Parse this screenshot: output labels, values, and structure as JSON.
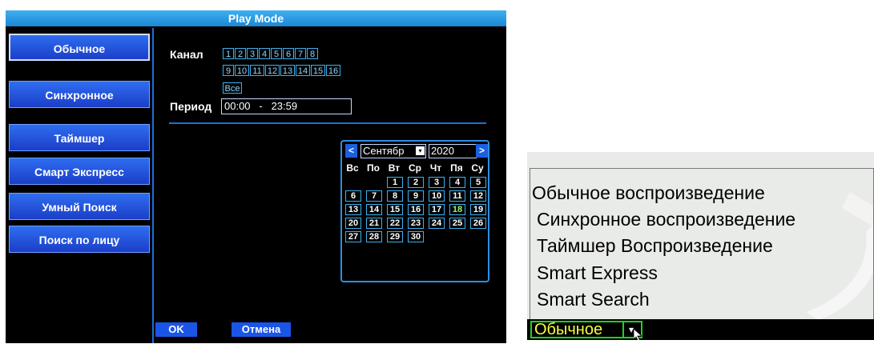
{
  "dvr": {
    "title": "Play Mode",
    "sidebar": [
      "Обычное",
      "Синхронное",
      "Таймшер",
      "Смарт Экспресс",
      "Умный Поиск",
      "Поиск по лицу"
    ],
    "channel_label": "Канал",
    "channels_row1": [
      "1",
      "2",
      "3",
      "4",
      "5",
      "6",
      "7",
      "8"
    ],
    "channels_row2": [
      "9",
      "10",
      "11",
      "12",
      "13",
      "14",
      "15",
      "16"
    ],
    "all_label": "Все",
    "period_label": "Период",
    "period_start": "00:00",
    "period_sep": "-",
    "period_end": "23:59",
    "calendar": {
      "prev": "<",
      "next": ">",
      "month": "Сентябр",
      "year": "2020",
      "weekdays": [
        "Вс",
        "По",
        "Вт",
        "Ср",
        "Чт",
        "Пя",
        "Су"
      ],
      "days": [
        "1",
        "2",
        "3",
        "4",
        "5",
        "6",
        "7",
        "8",
        "9",
        "10",
        "11",
        "12",
        "13",
        "14",
        "15",
        "16",
        "17",
        "18",
        "19",
        "20",
        "21",
        "22",
        "23",
        "24",
        "25",
        "26",
        "27",
        "28",
        "29",
        "30"
      ],
      "today": "18",
      "first_col": 2
    },
    "ok_label": "OK",
    "cancel_label": "Отмена"
  },
  "dropdown": {
    "options": [
      "Обычное воспроизведение",
      "Синхронное воспроизведение",
      "Таймшер Воспроизведение",
      "Smart Express",
      "Smart Search"
    ],
    "selected": "Обычное"
  },
  "colors": {
    "accent": "#1b55e8",
    "title": "#1b86d6",
    "channel": "#3bb2f0",
    "today": "#9cff5a",
    "selected_text": "#f4ff44",
    "selected_border": "#1fd21f"
  }
}
